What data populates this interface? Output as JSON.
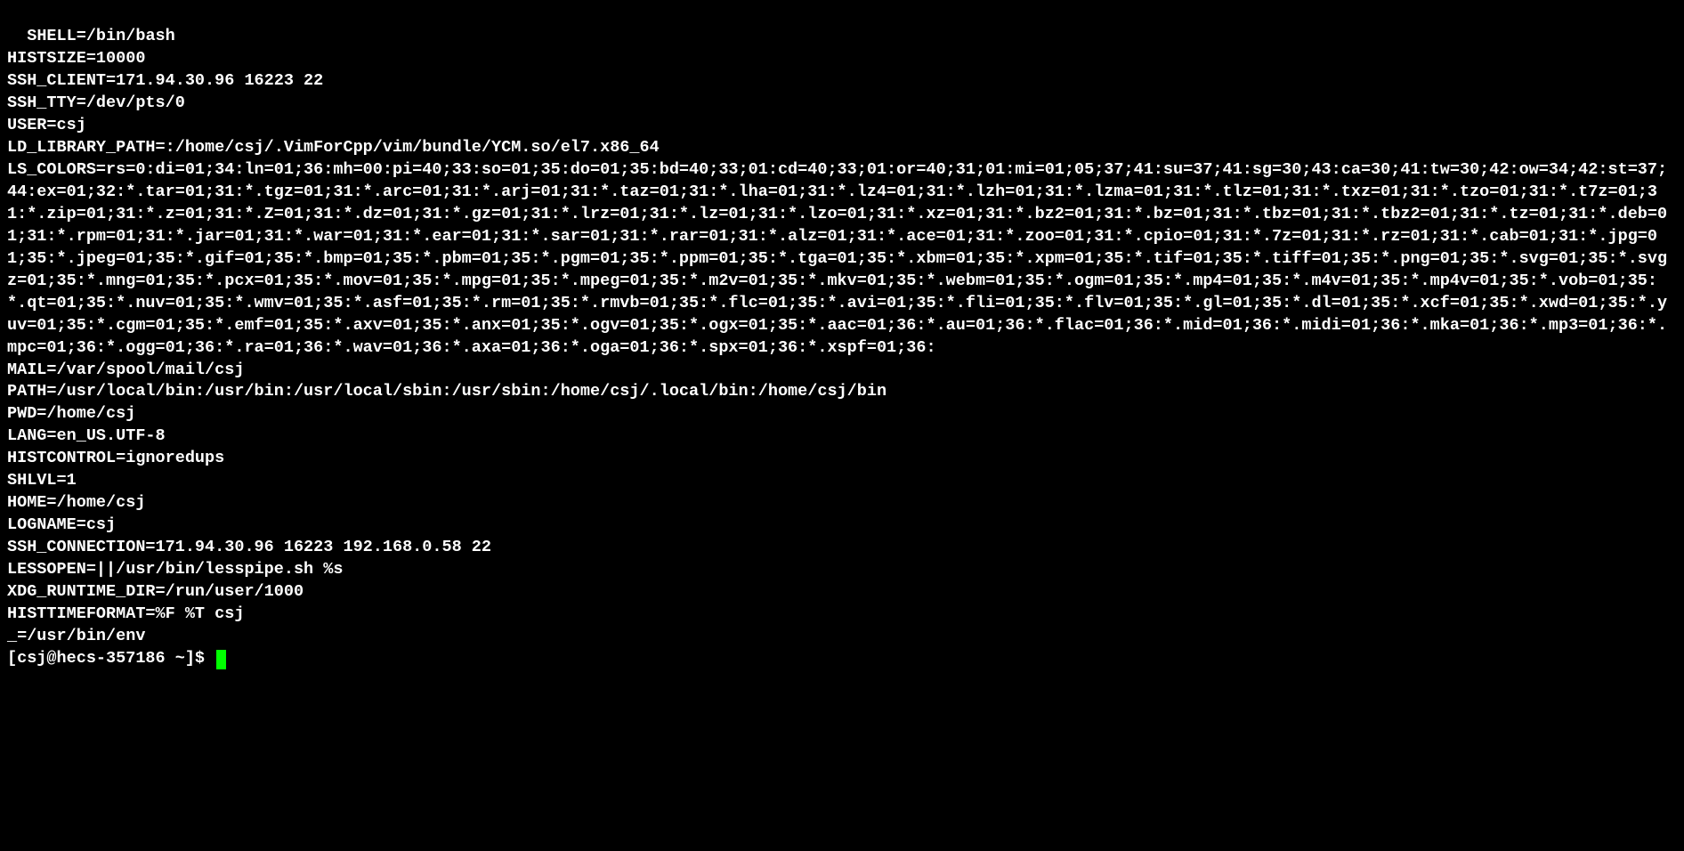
{
  "terminal": {
    "output": "SHELL=/bin/bash\nHISTSIZE=10000\nSSH_CLIENT=171.94.30.96 16223 22\nSSH_TTY=/dev/pts/0\nUSER=csj\nLD_LIBRARY_PATH=:/home/csj/.VimForCpp/vim/bundle/YCM.so/el7.x86_64\nLS_COLORS=rs=0:di=01;34:ln=01;36:mh=00:pi=40;33:so=01;35:do=01;35:bd=40;33;01:cd=40;33;01:or=40;31;01:mi=01;05;37;41:su=37;41:sg=30;43:ca=30;41:tw=30;42:ow=34;42:st=37;44:ex=01;32:*.tar=01;31:*.tgz=01;31:*.arc=01;31:*.arj=01;31:*.taz=01;31:*.lha=01;31:*.lz4=01;31:*.lzh=01;31:*.lzma=01;31:*.tlz=01;31:*.txz=01;31:*.tzo=01;31:*.t7z=01;31:*.zip=01;31:*.z=01;31:*.Z=01;31:*.dz=01;31:*.gz=01;31:*.lrz=01;31:*.lz=01;31:*.lzo=01;31:*.xz=01;31:*.bz2=01;31:*.bz=01;31:*.tbz=01;31:*.tbz2=01;31:*.tz=01;31:*.deb=01;31:*.rpm=01;31:*.jar=01;31:*.war=01;31:*.ear=01;31:*.sar=01;31:*.rar=01;31:*.alz=01;31:*.ace=01;31:*.zoo=01;31:*.cpio=01;31:*.7z=01;31:*.rz=01;31:*.cab=01;31:*.jpg=01;35:*.jpeg=01;35:*.gif=01;35:*.bmp=01;35:*.pbm=01;35:*.pgm=01;35:*.ppm=01;35:*.tga=01;35:*.xbm=01;35:*.xpm=01;35:*.tif=01;35:*.tiff=01;35:*.png=01;35:*.svg=01;35:*.svgz=01;35:*.mng=01;35:*.pcx=01;35:*.mov=01;35:*.mpg=01;35:*.mpeg=01;35:*.m2v=01;35:*.mkv=01;35:*.webm=01;35:*.ogm=01;35:*.mp4=01;35:*.m4v=01;35:*.mp4v=01;35:*.vob=01;35:*.qt=01;35:*.nuv=01;35:*.wmv=01;35:*.asf=01;35:*.rm=01;35:*.rmvb=01;35:*.flc=01;35:*.avi=01;35:*.fli=01;35:*.flv=01;35:*.gl=01;35:*.dl=01;35:*.xcf=01;35:*.xwd=01;35:*.yuv=01;35:*.cgm=01;35:*.emf=01;35:*.axv=01;35:*.anx=01;35:*.ogv=01;35:*.ogx=01;35:*.aac=01;36:*.au=01;36:*.flac=01;36:*.mid=01;36:*.midi=01;36:*.mka=01;36:*.mp3=01;36:*.mpc=01;36:*.ogg=01;36:*.ra=01;36:*.wav=01;36:*.axa=01;36:*.oga=01;36:*.spx=01;36:*.xspf=01;36:\nMAIL=/var/spool/mail/csj\nPATH=/usr/local/bin:/usr/bin:/usr/local/sbin:/usr/sbin:/home/csj/.local/bin:/home/csj/bin\nPWD=/home/csj\nLANG=en_US.UTF-8\nHISTCONTROL=ignoredups\nSHLVL=1\nHOME=/home/csj\nLOGNAME=csj\nSSH_CONNECTION=171.94.30.96 16223 192.168.0.58 22\nLESSOPEN=||/usr/bin/lesspipe.sh %s\nXDG_RUNTIME_DIR=/run/user/1000\nHISTTIMEFORMAT=%F %T csj \n_=/usr/bin/env",
    "prompt": "[csj@hecs-357186 ~]$ "
  }
}
